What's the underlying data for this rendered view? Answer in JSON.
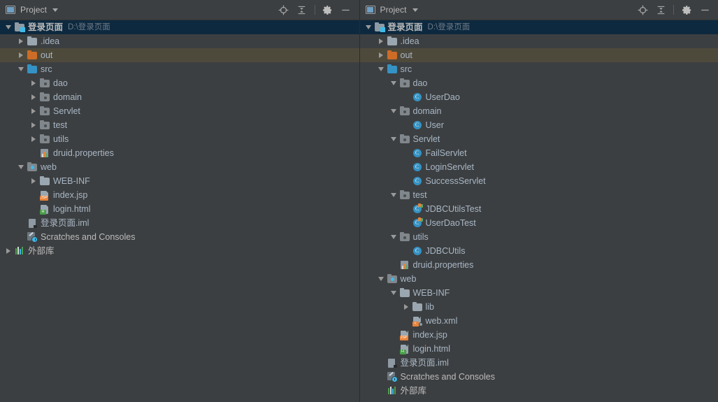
{
  "window": {
    "background_color": "#3c3f41",
    "selected_row_color": "#0d293f",
    "highlight_row_color": "#4e4a3b"
  },
  "header": {
    "title": "Project",
    "window_icon": "project-window-icon",
    "dropdown_icon": "chevron-down-icon",
    "actions": [
      {
        "name": "locate-icon",
        "tooltip": "Select Opened File"
      },
      {
        "name": "collapse-all-icon",
        "tooltip": "Collapse All"
      },
      {
        "name": "settings-gear-icon",
        "tooltip": "Settings"
      },
      {
        "name": "minimize-icon",
        "tooltip": "Hide"
      }
    ]
  },
  "panels": [
    {
      "id": "left-panel",
      "header": {
        "title": "Project"
      },
      "tree": [
        {
          "label": "登录页面",
          "path": "D:\\登录页面",
          "icon": "project-folder-icon",
          "indent": 0,
          "arrow": "down",
          "state": "selected",
          "bold": true
        },
        {
          "label": ".idea",
          "icon": "folder-icon",
          "indent": 1,
          "arrow": "right"
        },
        {
          "label": "out",
          "icon": "folder-orange-icon",
          "indent": 1,
          "arrow": "right",
          "state": "highlighted"
        },
        {
          "label": "src",
          "icon": "source-root-folder-icon",
          "indent": 1,
          "arrow": "down"
        },
        {
          "label": "dao",
          "icon": "package-icon",
          "indent": 2,
          "arrow": "right"
        },
        {
          "label": "domain",
          "icon": "package-icon",
          "indent": 2,
          "arrow": "right"
        },
        {
          "label": "Servlet",
          "icon": "package-icon",
          "indent": 2,
          "arrow": "right"
        },
        {
          "label": "test",
          "icon": "package-icon",
          "indent": 2,
          "arrow": "right"
        },
        {
          "label": "utils",
          "icon": "package-icon",
          "indent": 2,
          "arrow": "right"
        },
        {
          "label": "druid.properties",
          "icon": "properties-file-icon",
          "indent": 2,
          "arrow": "none"
        },
        {
          "label": "web",
          "icon": "web-folder-icon",
          "indent": 1,
          "arrow": "down"
        },
        {
          "label": "WEB-INF",
          "icon": "folder-icon",
          "indent": 2,
          "arrow": "right"
        },
        {
          "label": "index.jsp",
          "icon": "jsp-file-icon",
          "indent": 2,
          "arrow": "none"
        },
        {
          "label": "login.html",
          "icon": "html-file-icon",
          "indent": 2,
          "arrow": "none"
        },
        {
          "label": "登录页面.iml",
          "icon": "iml-file-icon",
          "indent": 1,
          "arrow": "none"
        },
        {
          "label": "Scratches and Consoles",
          "icon": "scratches-icon",
          "indent": 1,
          "arrow": "none",
          "white": true
        },
        {
          "label": "外部库",
          "icon": "external-libraries-icon",
          "indent": 0,
          "arrow": "right",
          "white": true
        }
      ]
    },
    {
      "id": "right-panel",
      "header": {
        "title": "Project"
      },
      "tree": [
        {
          "label": "登录页面",
          "path": "D:\\登录页面",
          "icon": "project-folder-icon",
          "indent": 0,
          "arrow": "down",
          "state": "selected",
          "bold": true
        },
        {
          "label": ".idea",
          "icon": "folder-icon",
          "indent": 1,
          "arrow": "right"
        },
        {
          "label": "out",
          "icon": "folder-orange-icon",
          "indent": 1,
          "arrow": "right",
          "state": "highlighted"
        },
        {
          "label": "src",
          "icon": "source-root-folder-icon",
          "indent": 1,
          "arrow": "down"
        },
        {
          "label": "dao",
          "icon": "package-icon",
          "indent": 2,
          "arrow": "down"
        },
        {
          "label": "UserDao",
          "icon": "java-class-icon",
          "indent": 3,
          "arrow": "none"
        },
        {
          "label": "domain",
          "icon": "package-icon",
          "indent": 2,
          "arrow": "down"
        },
        {
          "label": "User",
          "icon": "java-class-icon",
          "indent": 3,
          "arrow": "none"
        },
        {
          "label": "Servlet",
          "icon": "package-icon",
          "indent": 2,
          "arrow": "down"
        },
        {
          "label": "FailServlet",
          "icon": "java-class-icon",
          "indent": 3,
          "arrow": "none"
        },
        {
          "label": "LoginServlet",
          "icon": "java-class-icon",
          "indent": 3,
          "arrow": "none"
        },
        {
          "label": "SuccessServlet",
          "icon": "java-class-icon",
          "indent": 3,
          "arrow": "none"
        },
        {
          "label": "test",
          "icon": "package-icon",
          "indent": 2,
          "arrow": "down"
        },
        {
          "label": "JDBCUtilsTest",
          "icon": "java-test-class-icon",
          "indent": 3,
          "arrow": "none"
        },
        {
          "label": "UserDaoTest",
          "icon": "java-test-class-icon",
          "indent": 3,
          "arrow": "none"
        },
        {
          "label": "utils",
          "icon": "package-icon",
          "indent": 2,
          "arrow": "down"
        },
        {
          "label": "JDBCUtils",
          "icon": "java-class-icon",
          "indent": 3,
          "arrow": "none"
        },
        {
          "label": "druid.properties",
          "icon": "properties-file-icon",
          "indent": 2,
          "arrow": "none"
        },
        {
          "label": "web",
          "icon": "web-folder-icon",
          "indent": 1,
          "arrow": "down"
        },
        {
          "label": "WEB-INF",
          "icon": "folder-icon",
          "indent": 2,
          "arrow": "down"
        },
        {
          "label": "lib",
          "icon": "folder-icon",
          "indent": 3,
          "arrow": "right"
        },
        {
          "label": "web.xml",
          "icon": "xml-file-icon",
          "indent": 3,
          "arrow": "none"
        },
        {
          "label": "index.jsp",
          "icon": "jsp-file-icon",
          "indent": 2,
          "arrow": "none"
        },
        {
          "label": "login.html",
          "icon": "html-file-icon",
          "indent": 2,
          "arrow": "none"
        },
        {
          "label": "登录页面.iml",
          "icon": "iml-file-icon",
          "indent": 1,
          "arrow": "none"
        },
        {
          "label": "Scratches and Consoles",
          "icon": "scratches-icon",
          "indent": 1,
          "arrow": "none",
          "white": true
        },
        {
          "label": "外部库",
          "icon": "external-libraries-icon",
          "indent": 1,
          "arrow": "none",
          "white": true
        }
      ]
    }
  ]
}
